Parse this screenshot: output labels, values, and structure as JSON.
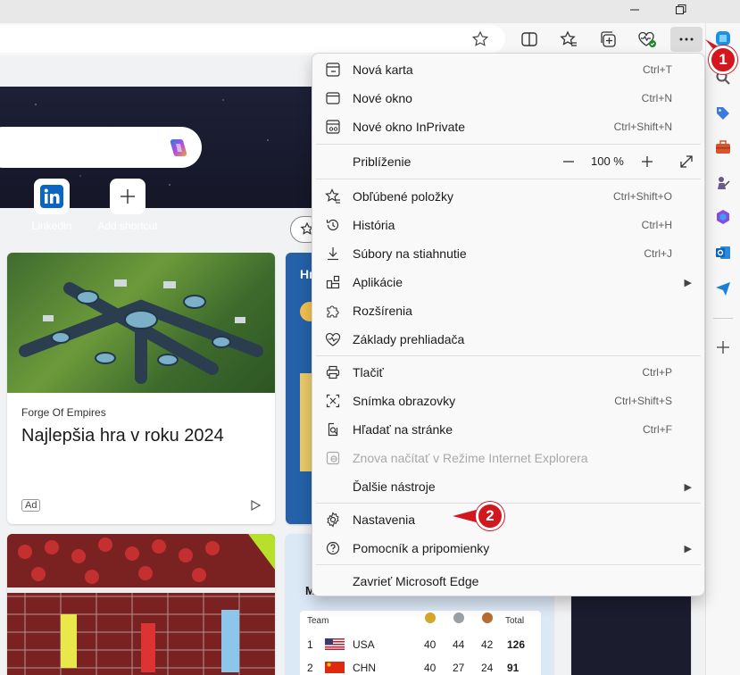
{
  "browser": {
    "colors": {
      "accent": "#0067c0",
      "annotation_red": "#d3171e"
    }
  },
  "hero": {
    "shortcuts": [
      {
        "label": "Linkedin",
        "icon": "linkedin-icon"
      },
      {
        "label": "Add shortcut",
        "icon": "plus-icon"
      }
    ]
  },
  "cards": {
    "ad": {
      "source": "Forge Of Empires",
      "title": "Najlepšia hra v roku 2024",
      "badge": "Ad"
    },
    "weather": {
      "title_partial": "Hr"
    },
    "medals": {
      "title_partial": "M",
      "columns": [
        "Team",
        "",
        "",
        "",
        "Total"
      ],
      "rows": [
        {
          "rank": "1",
          "team": "USA",
          "gold": "40",
          "silver": "44",
          "bronze": "42",
          "total": "126"
        },
        {
          "rank": "2",
          "team": "CHN",
          "gold": "40",
          "silver": "27",
          "bronze": "24",
          "total": "91"
        }
      ]
    }
  },
  "menu": {
    "items": [
      {
        "label": "Nová karta",
        "shortcut": "Ctrl+T",
        "icon": "new-tab-icon"
      },
      {
        "label": "Nové okno",
        "shortcut": "Ctrl+N",
        "icon": "new-window-icon"
      },
      {
        "label": "Nové okno InPrivate",
        "shortcut": "Ctrl+Shift+N",
        "icon": "inprivate-icon"
      },
      {
        "label": "Obľúbené položky",
        "shortcut": "Ctrl+Shift+O",
        "icon": "favorites-icon"
      },
      {
        "label": "História",
        "shortcut": "Ctrl+H",
        "icon": "history-icon"
      },
      {
        "label": "Súbory na stiahnutie",
        "shortcut": "Ctrl+J",
        "icon": "download-icon"
      },
      {
        "label": "Aplikácie",
        "shortcut": "",
        "icon": "apps-icon"
      },
      {
        "label": "Rozšírenia",
        "shortcut": "",
        "icon": "extensions-icon"
      },
      {
        "label": "Základy prehliadača",
        "shortcut": "",
        "icon": "browser-essentials-icon"
      },
      {
        "label": "Tlačiť",
        "shortcut": "Ctrl+P",
        "icon": "print-icon"
      },
      {
        "label": "Snímka obrazovky",
        "shortcut": "Ctrl+Shift+S",
        "icon": "screenshot-icon"
      },
      {
        "label": "Hľadať na stránke",
        "shortcut": "Ctrl+F",
        "icon": "find-icon"
      },
      {
        "label": "Znova načítať v Režime Internet Explorera",
        "shortcut": "",
        "icon": "ie-mode-icon"
      },
      {
        "label": "Ďalšie nástroje",
        "shortcut": "",
        "icon": ""
      },
      {
        "label": "Nastavenia",
        "shortcut": "",
        "icon": "settings-icon"
      },
      {
        "label": "Pomocník a pripomienky",
        "shortcut": "",
        "icon": "help-icon"
      },
      {
        "label": "Zavrieť Microsoft Edge",
        "shortcut": "",
        "icon": ""
      }
    ],
    "zoom": {
      "label": "Priblíženie",
      "value": "100 %",
      "minus": "—",
      "plus": "+"
    }
  },
  "annotations": [
    {
      "number": "1",
      "target": "settings-and-more-button"
    },
    {
      "number": "2",
      "target": "menu-item-settings"
    }
  ]
}
